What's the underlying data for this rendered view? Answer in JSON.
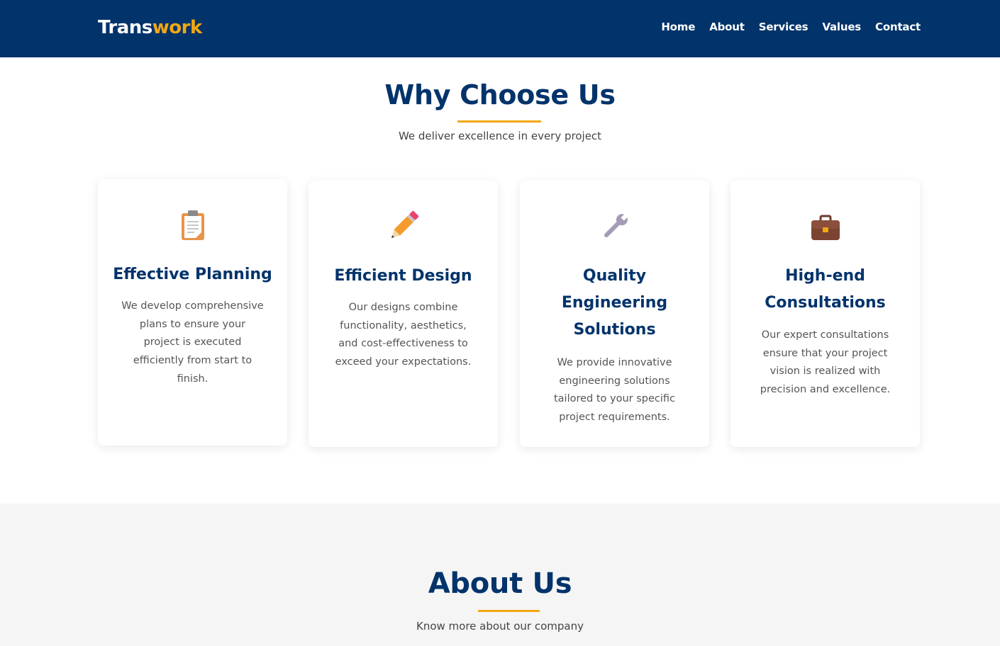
{
  "brand": {
    "part1": "Trans",
    "part2": "work"
  },
  "nav": {
    "home": "Home",
    "about": "About",
    "services": "Services",
    "values": "Values",
    "contact": "Contact"
  },
  "why": {
    "title": "Why Choose Us",
    "subtitle": "We deliver excellence in every project",
    "cards": [
      {
        "icon": "clipboard-icon",
        "title": "Effective Planning",
        "text": "We develop comprehensive plans to ensure your project is executed efficiently from start to finish."
      },
      {
        "icon": "pencil-icon",
        "title": "Efficient Design",
        "text": "Our designs combine functionality, aesthetics, and cost-effectiveness to exceed your expectations."
      },
      {
        "icon": "wrench-icon",
        "title": "Quality Engineering Solutions",
        "text": "We provide innovative engineering solutions tailored to your specific project requirements."
      },
      {
        "icon": "briefcase-icon",
        "title": "High-end Consultations",
        "text": "Our expert consultations ensure that your project vision is realized with precision and excellence."
      }
    ]
  },
  "about": {
    "title": "About Us",
    "subtitle": "Know more about our company"
  },
  "colors": {
    "navy": "#02336b",
    "accent": "#f3a712",
    "about_bg": "#f5f5f5"
  }
}
